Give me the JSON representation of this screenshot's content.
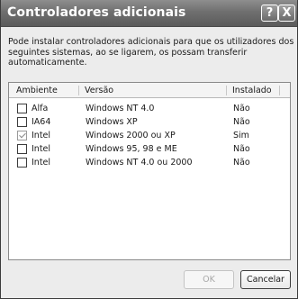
{
  "window": {
    "title": "Controladores adicionais",
    "help_label": "?",
    "close_label": "X"
  },
  "description": {
    "lines": [
      "Pode instalar controladores adicionais para que os utilizadores dos",
      "seguintes sistemas, ao se ligarem, os possam transferir",
      "automaticamente."
    ]
  },
  "table": {
    "columns": [
      "Ambiente",
      "Versão",
      "Instalado"
    ],
    "rows": [
      {
        "ambiente": "Alfa",
        "versao": "Windows NT 4.0",
        "instalado": "Não",
        "checked": false
      },
      {
        "ambiente": "IA64",
        "versao": "Windows XP",
        "instalado": "Não",
        "checked": false
      },
      {
        "ambiente": "Intel",
        "versao": "Windows 2000 ou XP",
        "instalado": "Sim",
        "checked": true
      },
      {
        "ambiente": "Intel",
        "versao": "Windows 95, 98 e ME",
        "instalado": "Não",
        "checked": false
      },
      {
        "ambiente": "Intel",
        "versao": "Windows NT 4.0 ou 2000",
        "instalado": "Não",
        "checked": false
      }
    ]
  },
  "buttons": {
    "ok_label": "OK",
    "cancel_label": "Cancelar"
  }
}
